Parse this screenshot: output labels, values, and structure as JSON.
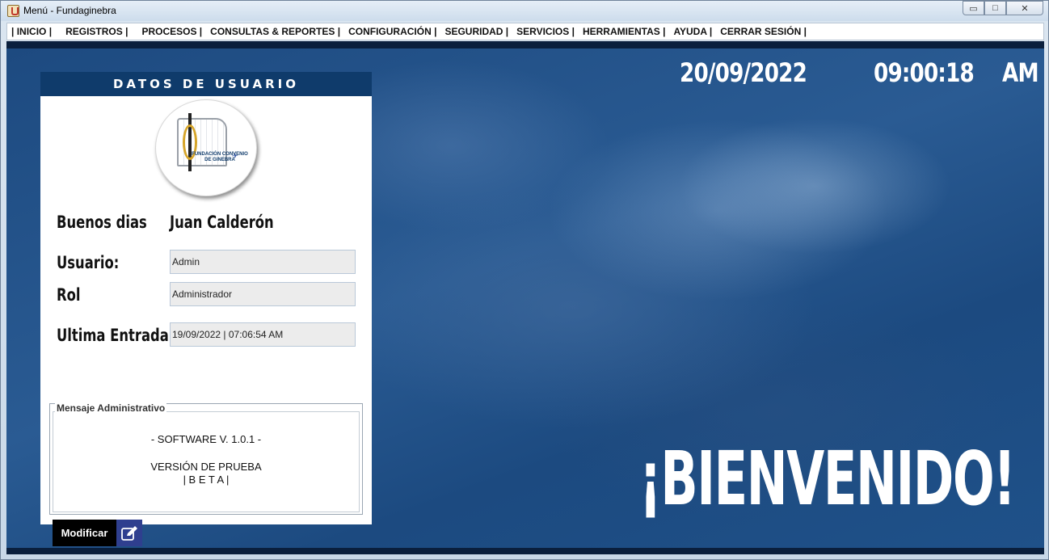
{
  "window": {
    "title": "Menú - Fundaginebra",
    "controls": {
      "minimize": "▭",
      "maximize": "□",
      "close": "✕"
    }
  },
  "menu": [
    "| INICIO |",
    "REGISTROS |",
    "PROCESOS |",
    "CONSULTAS & REPORTES |",
    "CONFIGURACIÓN |",
    "SEGURIDAD |",
    "SERVICIOS |",
    "HERRAMIENTAS |",
    "AYUDA |",
    "CERRAR SESIÓN |"
  ],
  "clock": {
    "date": "20/09/2022",
    "time": "09:00:18",
    "period": "AM"
  },
  "welcome": "¡BIENVENIDO!",
  "panel": {
    "header": "DATOS DE USUARIO",
    "logo_text": "FUNDACIÓN CONVENIO DE GINEBRA",
    "greeting": "Buenos dias",
    "user_name": "Juan Calderón",
    "usuario_label": "Usuario:",
    "usuario_value": "Admin",
    "rol_label": "Rol",
    "rol_value": "Administrador",
    "entrada_label": "Ultima Entrada:",
    "entrada_value": "19/09/2022 | 07:06:54 AM",
    "message": {
      "legend": "Mensaje Administrativo",
      "line1": "- SOFTWARE V. 1.0.1 -",
      "line2": "VERSIÓN DE PRUEBA",
      "line3": "| B E T A |"
    },
    "modify_button": "Modificar"
  },
  "colors": {
    "panel_header": "#0f3b6b",
    "background": "#1f4f86",
    "modify_icon_bg": "#2f3f8f"
  },
  "icons": {
    "app": "java-cup-icon",
    "edit": "edit-icon"
  }
}
